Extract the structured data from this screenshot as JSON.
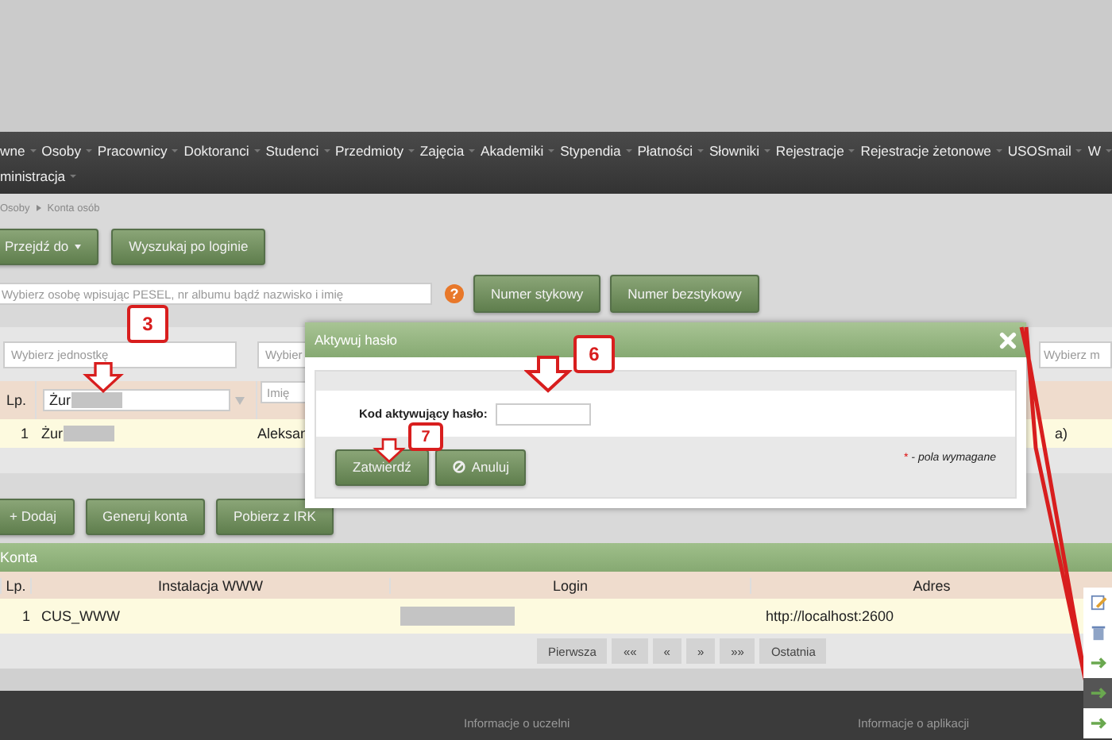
{
  "nav": {
    "row1": [
      "wne",
      "Osoby",
      "Pracownicy",
      "Doktoranci",
      "Studenci",
      "Przedmioty",
      "Zajęcia",
      "Akademiki",
      "Stypendia",
      "Płatności",
      "Słowniki",
      "Rejestracje",
      "Rejestracje żetonowe",
      "USOSmail",
      "W"
    ],
    "row2": [
      "ministracja"
    ]
  },
  "breadcrumb": [
    "Osoby",
    "Konta osób"
  ],
  "toolbar": [
    {
      "label": "Przejdź do",
      "kind": "dropdown"
    },
    {
      "label": "Wyszukaj po loginie",
      "kind": "plain"
    }
  ],
  "search": {
    "placeholder": "Wybierz osobę wpisując PESEL, nr albumu bądź nazwisko i imię",
    "help": "?",
    "buttons": [
      "Numer stykowy",
      "Numer bezstykowy"
    ]
  },
  "filters": {
    "unit_placeholder": "Wybierz jednostkę",
    "second_placeholder": "Wybier",
    "third_placeholder": "Wybierz m"
  },
  "people_table": {
    "lp_header": "Lp.",
    "surname_filter": "Żur",
    "first_name_placeholder": "Imię",
    "rows": [
      {
        "lp": "1",
        "surname": "Żur",
        "first_name": "Aleksan",
        "column_4": "a)"
      }
    ]
  },
  "actions": [
    "+ Dodaj",
    "Generuj konta",
    "Pobierz z IRK"
  ],
  "accounts": {
    "title": "Konta",
    "columns": [
      "Lp.",
      "Instalacja WWW",
      "Login",
      "Adres"
    ],
    "rows": [
      {
        "lp": "1",
        "installation": "CUS_WWW",
        "address": "http://localhost:2600"
      }
    ],
    "pagination": [
      "Pierwsza",
      "««",
      "«",
      "»",
      "»»",
      "Ostatnia"
    ]
  },
  "footer": [
    "Informacje o uczelni",
    "Informacje o aplikacji"
  ],
  "dialog": {
    "title": "Aktywuj hasło",
    "field_label": "Kod aktywujący hasło:",
    "confirm": "Zatwierdź",
    "cancel": "Anuluj",
    "required_mark": "*",
    "required_note": " - pola wymagane"
  },
  "callouts": [
    "3",
    "6",
    "7"
  ],
  "context_menu": [
    {
      "kind": "edit",
      "selected": false
    },
    {
      "kind": "delete",
      "selected": false
    },
    {
      "kind": "arrow",
      "selected": false
    },
    {
      "kind": "arrow",
      "selected": true
    },
    {
      "kind": "arrow",
      "selected": false
    }
  ]
}
